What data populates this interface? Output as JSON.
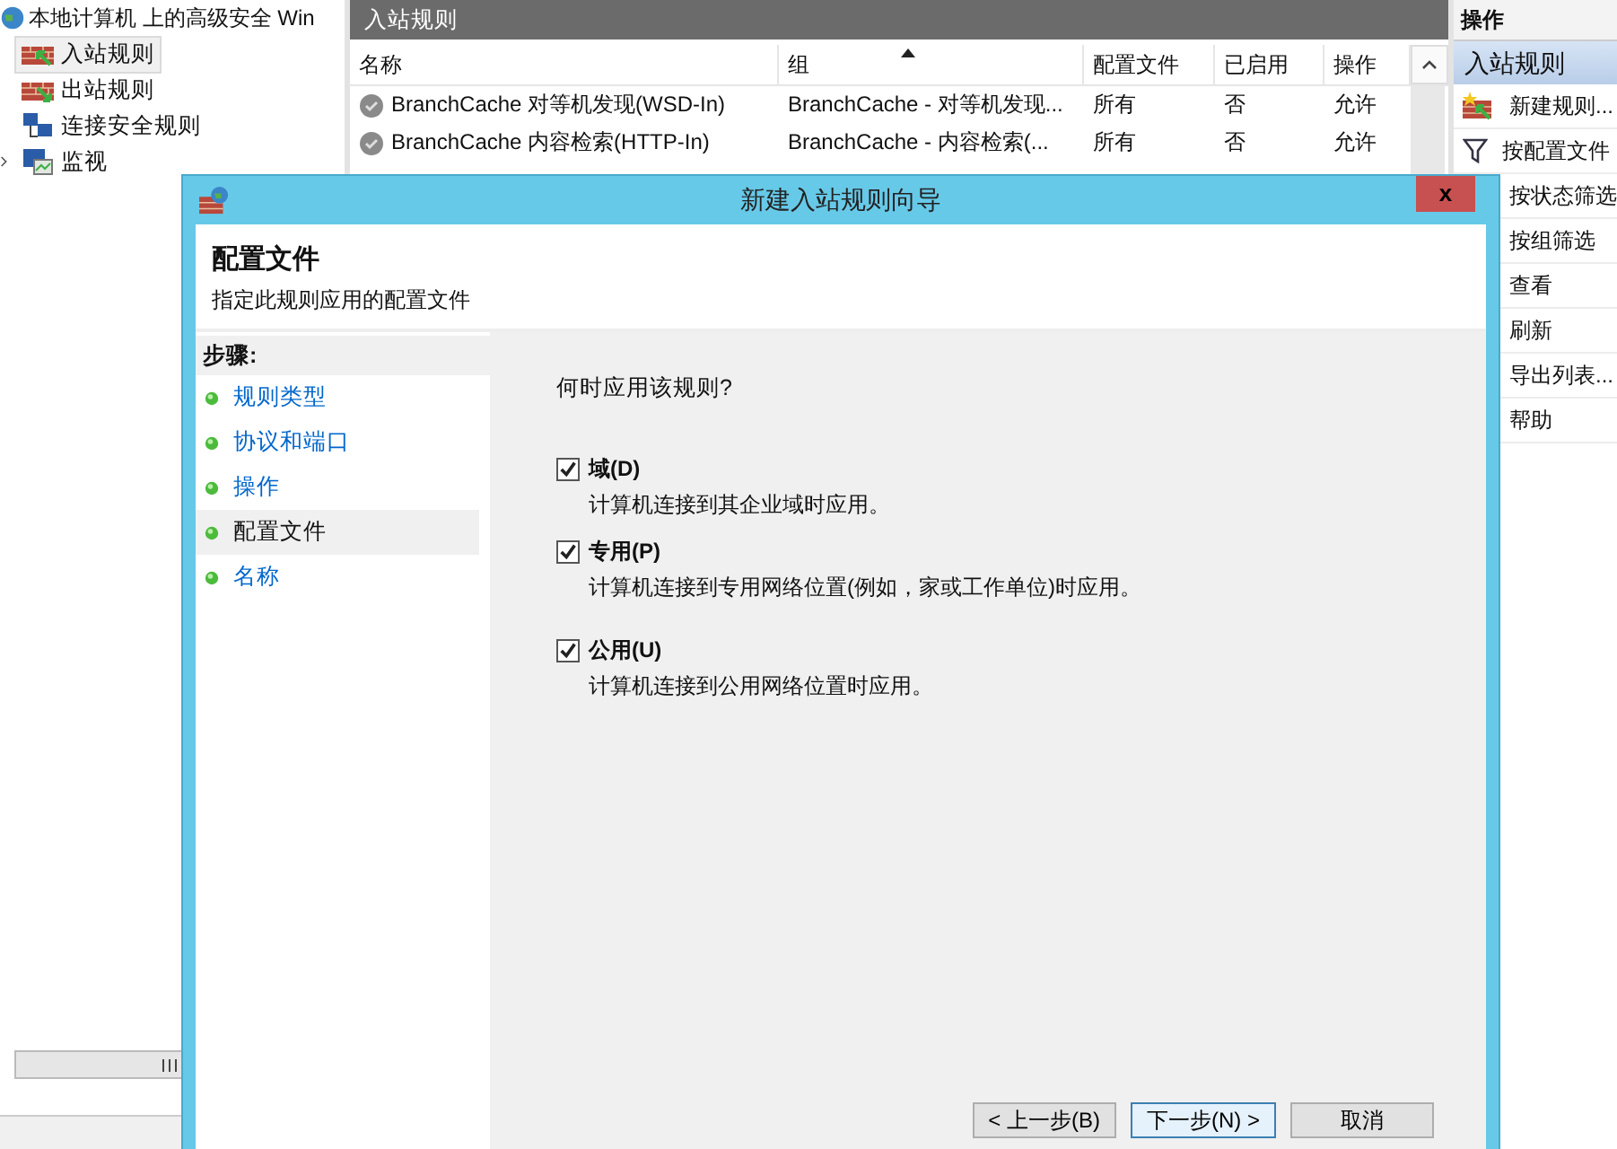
{
  "tree": {
    "title": "本地计算机 上的高级安全 Win",
    "items": [
      {
        "label": "入站规则",
        "kind": "inbound",
        "selected": true,
        "has_children": false
      },
      {
        "label": "出站规则",
        "kind": "outbound",
        "selected": false,
        "has_children": false
      },
      {
        "label": "连接安全规则",
        "kind": "connection",
        "selected": false,
        "has_children": false
      },
      {
        "label": "监视",
        "kind": "monitor",
        "selected": false,
        "has_children": true
      }
    ]
  },
  "list_pane": {
    "title": "入站规则",
    "columns": [
      {
        "label": "名称",
        "sorted": false
      },
      {
        "label": "组",
        "sorted": true
      },
      {
        "label": "配置文件",
        "sorted": false
      },
      {
        "label": "已启用",
        "sorted": false
      },
      {
        "label": "操作",
        "sorted": false
      }
    ],
    "rows": [
      {
        "name": "BranchCache 对等机发现(WSD-In)",
        "group": "BranchCache - 对等机发现...",
        "profile": "所有",
        "enabled": "否",
        "action": "允许"
      },
      {
        "name": "BranchCache 内容检索(HTTP-In)",
        "group": "BranchCache - 内容检索(...",
        "profile": "所有",
        "enabled": "否",
        "action": "允许"
      }
    ]
  },
  "actions": {
    "title": "操作",
    "section": "入站规则",
    "items": [
      {
        "label": "新建规则...",
        "kind": "new"
      },
      {
        "label": "按配置文件",
        "kind": "filter"
      },
      {
        "label": "按状态筛选",
        "kind": "plain"
      },
      {
        "label": "按组筛选",
        "kind": "plain"
      },
      {
        "label": "查看",
        "kind": "plain"
      },
      {
        "label": "刷新",
        "kind": "plain"
      },
      {
        "label": "导出列表...",
        "kind": "plain"
      },
      {
        "label": "帮助",
        "kind": "plain"
      }
    ]
  },
  "dialog": {
    "title": "新建入站规则向导",
    "close": "x",
    "heading": "配置文件",
    "subheading": "指定此规则应用的配置文件",
    "steps_title": "步骤:",
    "steps": [
      {
        "label": "规则类型",
        "selected": false
      },
      {
        "label": "协议和端口",
        "selected": false
      },
      {
        "label": "操作",
        "selected": false
      },
      {
        "label": "配置文件",
        "selected": true
      },
      {
        "label": "名称",
        "selected": false
      }
    ],
    "question": "何时应用该规则?",
    "options": [
      {
        "label": "域(D)",
        "description": "计算机连接到其企业域时应用。",
        "checked": true
      },
      {
        "label": "专用(P)",
        "description": "计算机连接到专用网络位置(例如，家或工作单位)时应用。",
        "checked": true
      },
      {
        "label": "公用(U)",
        "description": "计算机连接到公用网络位置时应用。",
        "checked": true
      }
    ],
    "buttons": [
      {
        "label": "< 上一步(B)",
        "focused": false
      },
      {
        "label": "下一步(N) >",
        "focused": true
      },
      {
        "label": "取消",
        "focused": false
      }
    ]
  }
}
